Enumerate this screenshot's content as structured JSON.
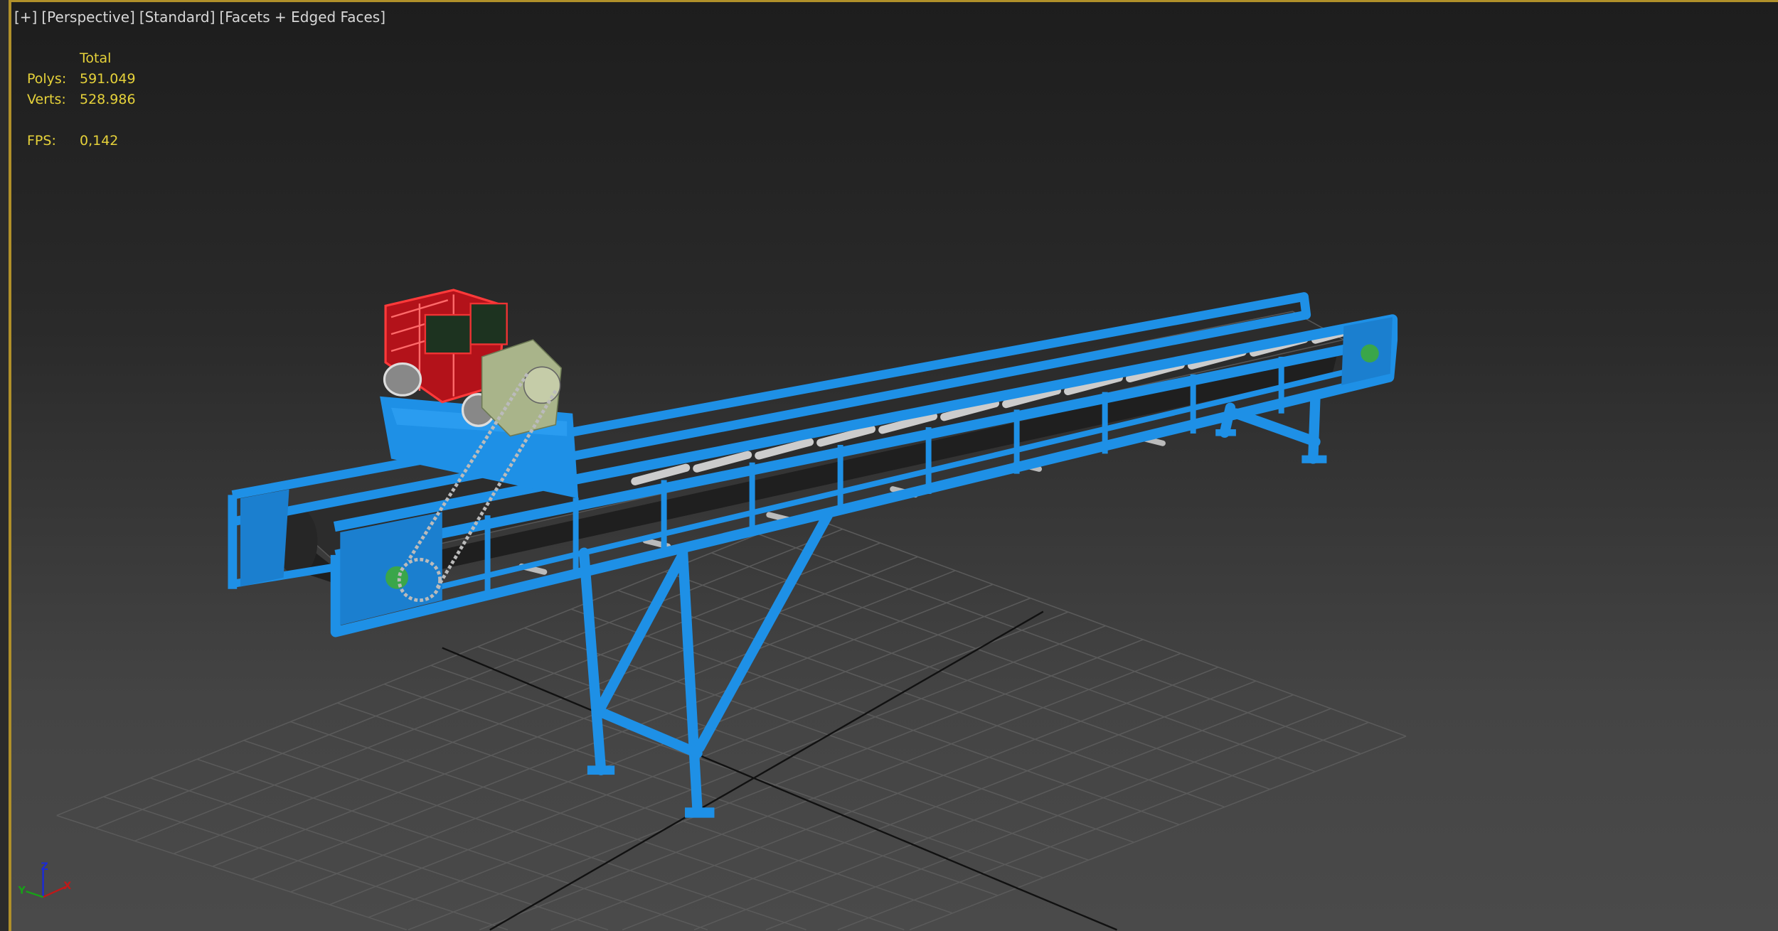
{
  "viewport": {
    "labels": [
      "[+]",
      "[Perspective]",
      "[Standard]",
      "[Facets + Edged Faces]"
    ]
  },
  "stats": {
    "header": "Total",
    "polys_label": "Polys:",
    "polys": "591.049",
    "verts_label": "Verts:",
    "verts": "528.986",
    "fps_label": "FPS:",
    "fps": "0,142"
  },
  "axis_gizmo": {
    "x": "X",
    "y": "Y",
    "z": "Z"
  },
  "colors": {
    "frame": "#1e90e6",
    "engine": "#e8202a",
    "gearbox": "#a9b48a",
    "belt": "#2a2a2a",
    "stats": "#e6d23a",
    "border": "#b0902a"
  }
}
